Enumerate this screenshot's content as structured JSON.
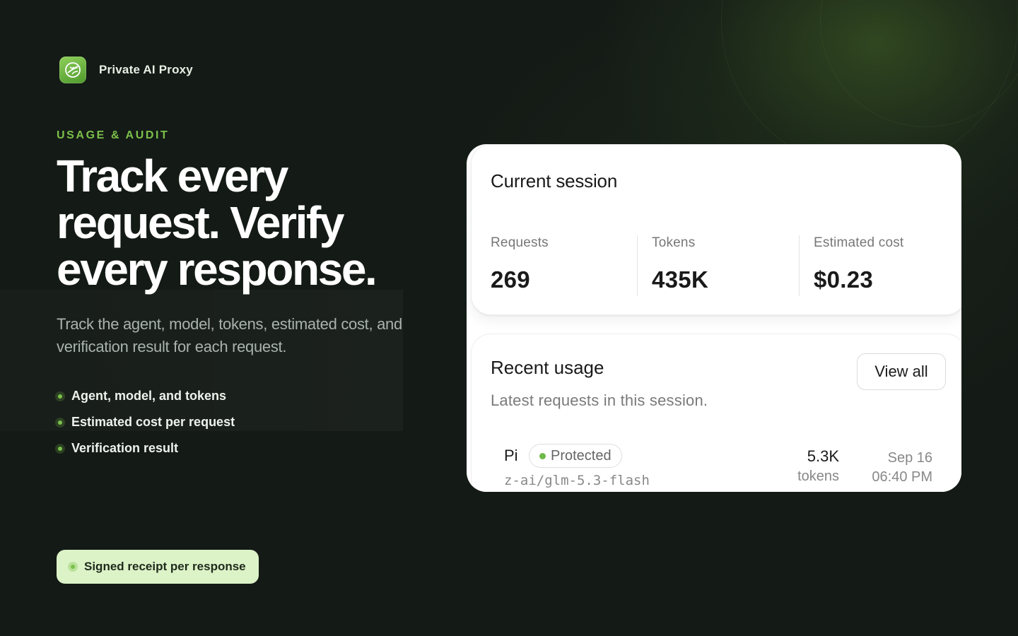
{
  "brand": {
    "name": "Private AI Proxy",
    "logo_icon": "brain-leaf-icon"
  },
  "hero": {
    "eyebrow": "USAGE & AUDIT",
    "headline": "Track every request. Verify every response.",
    "subtext": "Track the agent, model, tokens, estimated cost, and verification result for each request."
  },
  "features": [
    "Agent, model, and tokens",
    "Estimated cost per request",
    "Verification result"
  ],
  "receipt_badge": "Signed receipt per response",
  "session": {
    "title": "Current session",
    "stats": [
      {
        "label": "Requests",
        "value": "269"
      },
      {
        "label": "Tokens",
        "value": "435K"
      },
      {
        "label": "Estimated cost",
        "value": "$0.23"
      }
    ]
  },
  "recent": {
    "title": "Recent usage",
    "subtitle": "Latest requests in this session.",
    "view_all_label": "View all",
    "rows": [
      {
        "agent": "Pi",
        "status": "Protected",
        "model": "z-ai/glm-5.3-flash",
        "tokens": "5.3K",
        "tokens_unit": "tokens",
        "date": "Sep 16",
        "time": "06:40 PM"
      }
    ]
  },
  "colors": {
    "background": "#141a16",
    "accent": "#7bc04b",
    "receipt_bg": "#dcf3c7",
    "card_bg": "#ffffff",
    "status_dot": "#6fb84a"
  }
}
